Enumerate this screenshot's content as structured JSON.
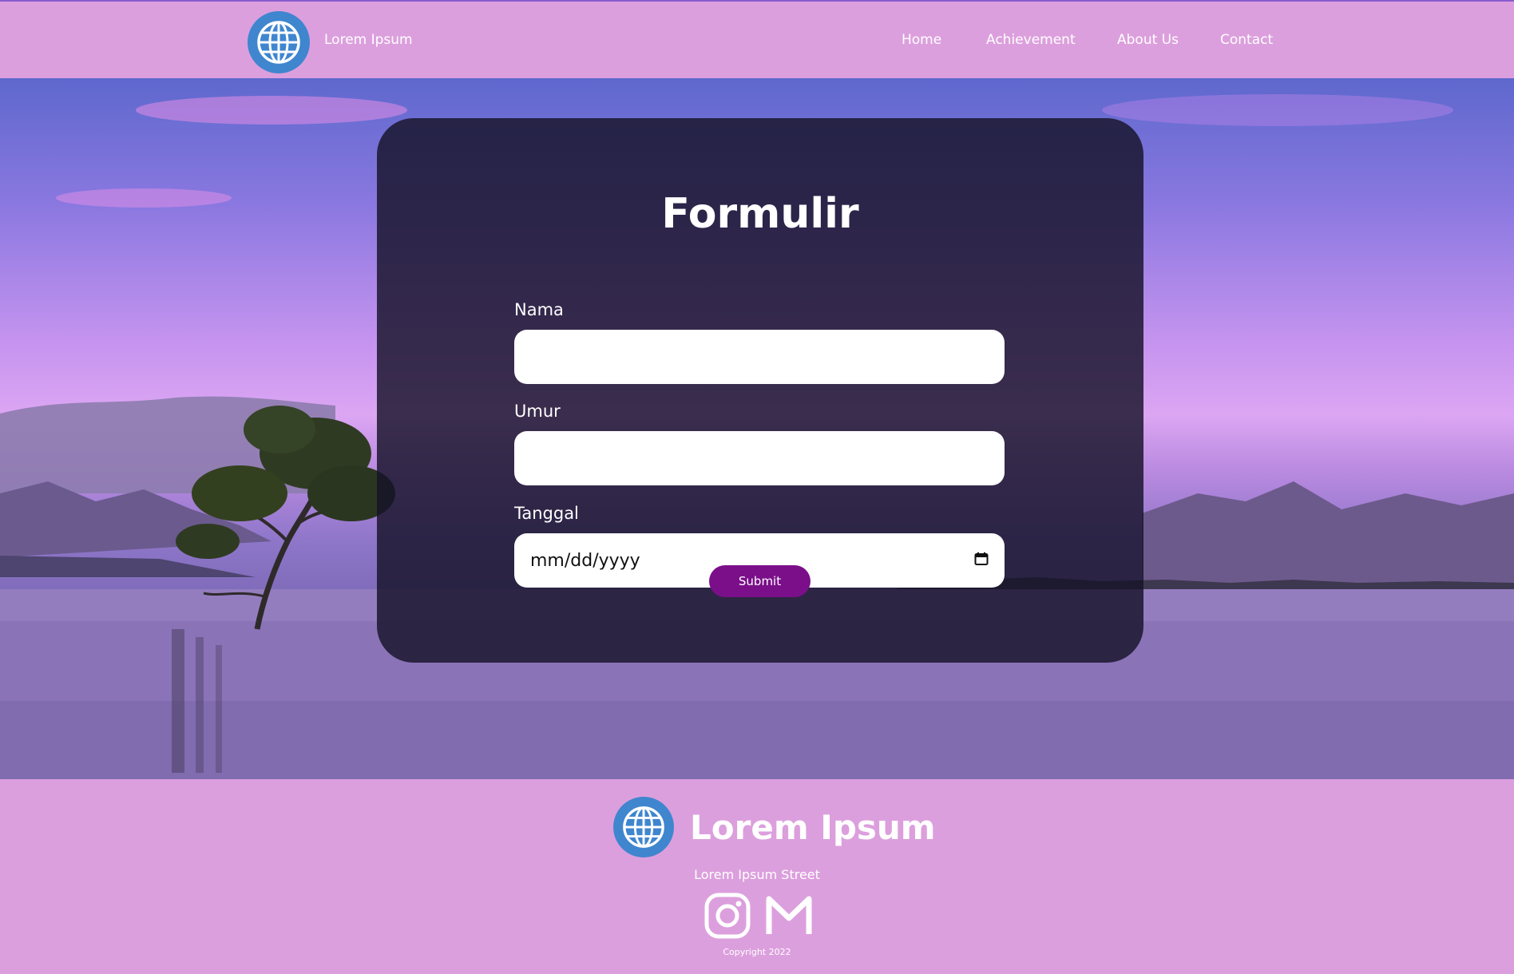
{
  "navbar": {
    "brand": "Lorem Ipsum",
    "logo_icon": "globe-icon",
    "links": [
      "Home",
      "Achievement",
      "About Us",
      "Contact"
    ]
  },
  "form": {
    "title": "Formulir",
    "fields": [
      {
        "label": "Nama",
        "value": ""
      },
      {
        "label": "Umur",
        "value": ""
      },
      {
        "label": "Tanggal",
        "value": "mm/dd/yyyy"
      }
    ],
    "date_icon": "calendar-icon",
    "submit_label": "Submit"
  },
  "footer": {
    "brand": "Lorem Ipsum",
    "address": "Lorem Ipsum Street",
    "social_icons": [
      "instagram-icon",
      "gmail-icon"
    ],
    "copyright": "Copyright 2022"
  },
  "colors": {
    "nav_footer_bg": "#dc9fdd",
    "logo_blue": "#3f86cf",
    "submit_purple": "#7b0f8a",
    "card_bg": "#161228"
  }
}
